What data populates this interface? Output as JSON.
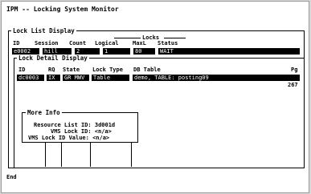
{
  "title": "IPM -- Locking System Monitor",
  "lock_list": {
    "legend": "Lock List Display",
    "locks_group": "Locks",
    "headers": [
      "ID",
      "Session",
      "Count",
      "Logical",
      "MaxL",
      "Status"
    ],
    "row": {
      "id": "e0002",
      "session": "hill",
      "count": "2",
      "logical": "1",
      "maxl": "80",
      "status": "WAIT"
    }
  },
  "lock_detail": {
    "legend": "Lock Detail Display",
    "headers": [
      "ID",
      "RQ",
      "State",
      "Lock Type",
      "DB Table",
      "Pg"
    ],
    "row": {
      "id": "dc0003",
      "rq": "IX",
      "state": "GR MWV",
      "lock_type": "Table",
      "db_table": "demo, TABLE: posting09"
    },
    "pg_value": "267"
  },
  "more_info": {
    "legend": "More Info",
    "resource_list_id": "Resource List ID: 3d001d",
    "vms_lock_id": "VMS Lock ID: <n/a>",
    "vms_lock_id_value": "VMS Lock ID Value: <n/a>"
  },
  "status_line": "End"
}
